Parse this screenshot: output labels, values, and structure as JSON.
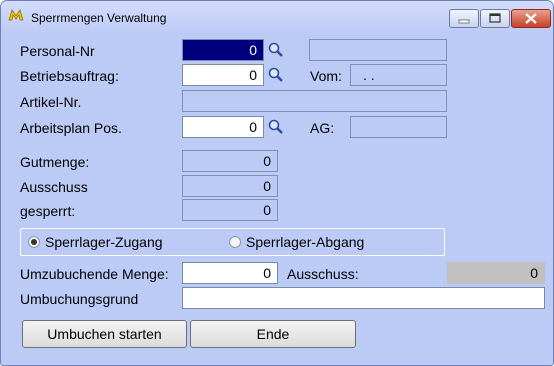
{
  "window": {
    "title": "Sperrmengen Verwaltung",
    "controls": [
      "minimize",
      "maximize",
      "close"
    ]
  },
  "form": {
    "personal_nr": {
      "label": "Personal-Nr",
      "value": "0"
    },
    "betriebsauftrag": {
      "label": "Betriebsauftrag:",
      "value": "0",
      "vom_label": "Vom:",
      "vom_value": ". ."
    },
    "artikel_nr": {
      "label": "Artikel-Nr.",
      "value": ""
    },
    "arbeitsplan_pos": {
      "label": "Arbeitsplan Pos.",
      "value": "0",
      "ag_label": "AG:",
      "ag_value": ""
    },
    "gutmenge": {
      "label": "Gutmenge:",
      "value": "0"
    },
    "ausschuss": {
      "label": "Ausschuss",
      "value": "0"
    },
    "gesperrt": {
      "label": "gesperrt:",
      "value": "0"
    },
    "radio": {
      "zugang": {
        "label": "Sperrlager-Zugang",
        "selected": true
      },
      "abgang": {
        "label": "Sperrlager-Abgang",
        "selected": false
      }
    },
    "umzubuchende_menge": {
      "label": "Umzubuchende Menge:",
      "value": "0",
      "ausschuss_label": "Ausschuss:",
      "ausschuss_value": "0"
    },
    "umbuchungsgrund": {
      "label": "Umbuchungsgrund",
      "value": ""
    }
  },
  "buttons": {
    "umbuchen": "Umbuchen starten",
    "ende": "Ende"
  },
  "icons": [
    "app-logo-icon",
    "search-icon"
  ]
}
